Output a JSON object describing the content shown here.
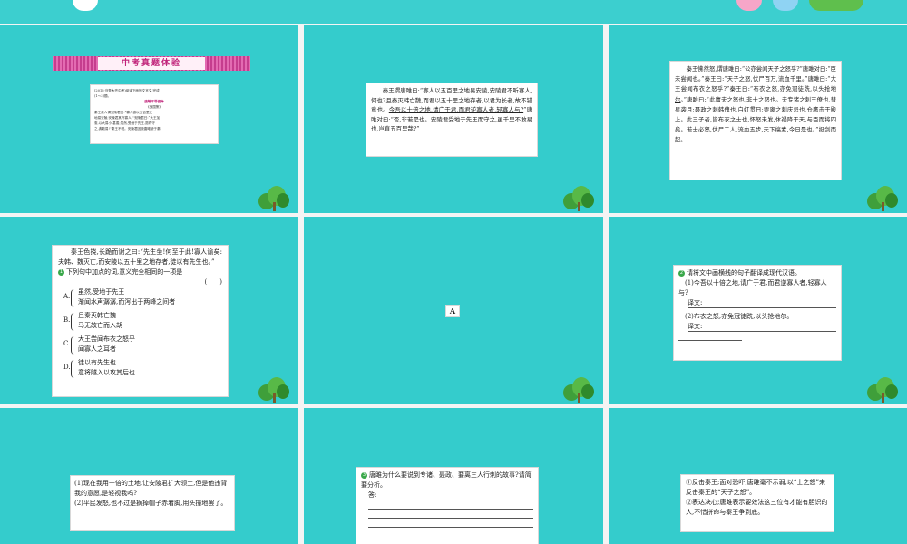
{
  "colors": {
    "slide_bg": "#34cccc",
    "banner": "#d94aa0"
  },
  "slide1": {
    "banner": "中考真题体验",
    "lines": [
      "(2016·乌鲁木齐中考)阅读下面的文言文,完成",
      "(1～3)题。",
      "唐雎不辱使命",
      "《战国策》",
      "秦王使人谓安陵君曰:“寡人欲以五百里之",
      "地易安陵,安陵君其许寡人!”安陵君曰:“大王加",
      "惠,以大易小,甚善;虽然,受地于先王,愿终守",
      "之,弗敢易!”秦王不悦。安陵君因使唐雎使于秦。"
    ]
  },
  "slide2": {
    "t1": "秦王谓唐雎曰:“寡人以五百里之地易安陵,安陵君不听寡人,何也?且秦灭韩亡魏,而君以五十里之地存者,以君为长者,故不错意也。",
    "u1": "今吾以十倍之地,请广于君,而君逆寡人者,轻寡人与?",
    "t2": "”唐雎对曰:“否,非若是也。安陵君受地于先王而守之,虽千里不敢易也,岂直五百里哉?”"
  },
  "slide3": {
    "t1": "秦王怫然怒,谓唐雎曰:“公亦尝闻天子之怒乎?”唐雎对曰:“臣未尝闻也。”秦王曰:“天子之怒,伏尸百万,流血千里。”唐雎曰:“大王尝闻布衣之怒乎?”秦王曰:“",
    "u1": "布衣之怒,亦免冠徒跣,以头抢地尔",
    "t2": "。”唐雎曰:“此庸夫之怒也,非士之怒也。夫专诸之刺王僚也,彗星袭月;聂政之刺韩傀也,白虹贯日;要离之刺庆忌也,仓鹰击于殿上。此三子者,皆布衣之士也,怀怒未发,休祲降于天,与臣而将四矣。若士必怒,伏尸二人,流血五步,天下缟素,今日是也。”挺剑而起。"
  },
  "slide4": {
    "t1": "秦王色挠,长跪而谢之曰:“先生坐!何至于此!寡人谕矣:夫韩、魏灭亡,而安陵以五十里之地存者,徒以有先生也。”",
    "q1_num": "❶",
    "q1": "下列句中加点的词,意义完全相同的一项是",
    "q1_paren": "(　　)",
    "options": [
      {
        "label": "A.",
        "l1": "虽然,受地于先王",
        "l2": "渐闻水声潺潺,而泻出于两峰之间者"
      },
      {
        "label": "B.",
        "l1": "且秦灭韩亡魏",
        "l2": "马无故亡而入胡"
      },
      {
        "label": "C.",
        "l1": "大王尝闻布衣之怒乎",
        "l2": "闻寡人之耳者"
      },
      {
        "label": "D.",
        "l1": "徒以有先生也",
        "l2": "意将隧入以攻其后也"
      }
    ]
  },
  "slide5": {
    "answer": "A"
  },
  "slide6": {
    "q_num": "❷",
    "q": "请将文中画横线的句子翻译成现代汉语。",
    "i1": "(1)今吾以十倍之地,请广于君,而君逆寡人者,轻寡人与?",
    "label": "译文:",
    "i2": "(2)布衣之怒,亦免冠徒跣,以头抢地尔。",
    "label2": "译文:"
  },
  "slide7": {
    "a1": "(1)现在我用十倍的土地,让安陵君扩大领土,但是他违背我的意愿,是轻视我吗?",
    "a2": "(2)平民发怒,也不过是摘掉帽子赤着脚,用头撞地罢了。"
  },
  "slide8": {
    "q_num": "❸",
    "q": "唐雎为什么要说到专诸、聂政、要离三人行刺的故事?请简要分析。",
    "label": "答:"
  },
  "slide9": {
    "a1": "①反击秦王;面对恐吓,唐雎毫不示弱,以“士之怒”来反击秦王的“天子之怒”。",
    "a2": "②表达决心;唐雎表示要效法这三位有才能有胆识的人,不惜拼命与秦王争到底。"
  }
}
